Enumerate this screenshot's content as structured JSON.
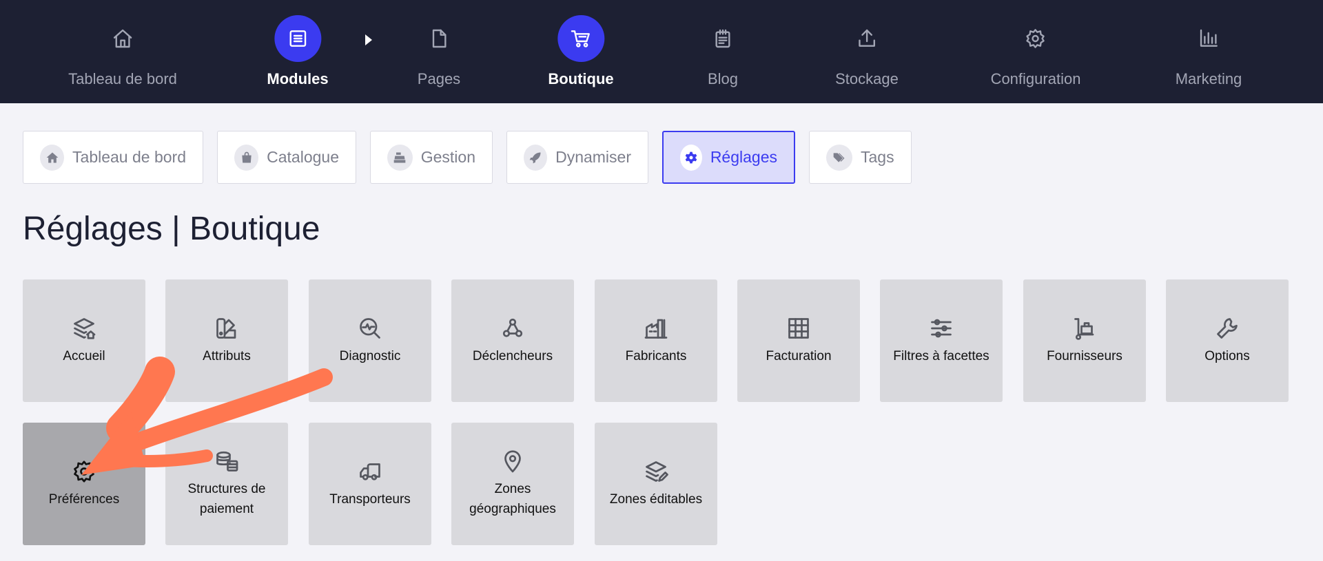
{
  "topnav": {
    "items": [
      {
        "label": "Tableau de bord",
        "icon": "home-icon",
        "active": false
      },
      {
        "label": "Modules",
        "icon": "list-icon",
        "active": true
      },
      {
        "label": "Pages",
        "icon": "page-icon",
        "active": false
      },
      {
        "label": "Boutique",
        "icon": "cart-icon",
        "active": true
      },
      {
        "label": "Blog",
        "icon": "notepad-icon",
        "active": false
      },
      {
        "label": "Stockage",
        "icon": "upload-icon",
        "active": false
      },
      {
        "label": "Configuration",
        "icon": "gear-icon",
        "active": false
      },
      {
        "label": "Marketing",
        "icon": "bar-chart-icon",
        "active": false
      }
    ]
  },
  "subtabs": [
    {
      "label": "Tableau de bord",
      "icon": "home-icon",
      "active": false
    },
    {
      "label": "Catalogue",
      "icon": "bag-icon",
      "active": false
    },
    {
      "label": "Gestion",
      "icon": "cash-register-icon",
      "active": false
    },
    {
      "label": "Dynamiser",
      "icon": "rocket-icon",
      "active": false
    },
    {
      "label": "Réglages",
      "icon": "gear-icon",
      "active": true
    },
    {
      "label": "Tags",
      "icon": "tags-icon",
      "active": false
    }
  ],
  "page": {
    "title": "Réglages | Boutique"
  },
  "tiles": [
    {
      "label": "Accueil",
      "icon": "layers-home-icon"
    },
    {
      "label": "Attributs",
      "icon": "swatch-icon"
    },
    {
      "label": "Diagnostic",
      "icon": "search-pulse-icon"
    },
    {
      "label": "Déclencheurs",
      "icon": "webhook-icon"
    },
    {
      "label": "Fabricants",
      "icon": "factory-icon"
    },
    {
      "label": "Facturation",
      "icon": "grid-table-icon"
    },
    {
      "label": "Filtres à facettes",
      "icon": "sliders-icon"
    },
    {
      "label": "Fournisseurs",
      "icon": "hand-truck-icon"
    },
    {
      "label": "Options",
      "icon": "wrench-icon"
    },
    {
      "label": "Préférences",
      "icon": "gear-icon",
      "selected": true
    },
    {
      "label": "Structures de paiement",
      "icon": "coins-icon"
    },
    {
      "label": "Transporteurs",
      "icon": "truck-icon"
    },
    {
      "label": "Zones géographiques",
      "icon": "map-pin-icon"
    },
    {
      "label": "Zones éditables",
      "icon": "layers-edit-icon"
    }
  ],
  "annotation": {
    "icon": "pointer-arrow-icon",
    "color": "#ff7750"
  }
}
